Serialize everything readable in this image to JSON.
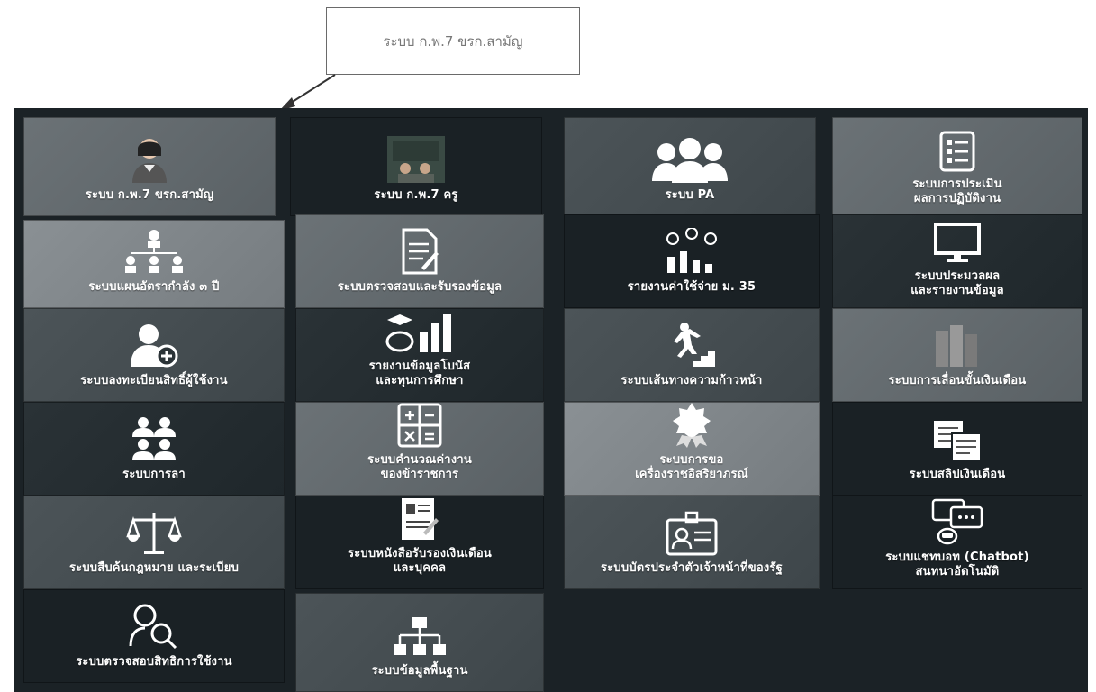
{
  "callout": {
    "text": "ระบบ ก.พ.7 ขรก.สามัญ"
  },
  "tiles": [
    {
      "label1": "ระบบ ก.พ.7 ขรก.สามัญ",
      "label2": "",
      "icon": "person-female-icon"
    },
    {
      "label1": "ระบบ ก.พ.7 ครู",
      "label2": "",
      "icon": "teacher-classroom-icon"
    },
    {
      "label1": "ระบบ PA",
      "label2": "",
      "icon": "people-group-icon"
    },
    {
      "label1": "ระบบการประเมิน",
      "label2": "ผลการปฏิบัติงาน",
      "icon": "checklist-icon"
    },
    {
      "label1": "ระบบแผนอัตรากำลัง ๓ ปี",
      "label2": "",
      "icon": "org-people-icon"
    },
    {
      "label1": "ระบบตรวจสอบและรับรองข้อมูล",
      "label2": "",
      "icon": "document-sign-icon"
    },
    {
      "label1": "รายงานค่าใช้จ่าย ม. 35",
      "label2": "",
      "icon": "money-chart-icon"
    },
    {
      "label1": "ระบบประมวลผล",
      "label2": "และรายงานข้อมูล",
      "icon": "monitor-icon"
    },
    {
      "label1": "ระบบลงทะเบียนสิทธิ์ผู้ใช้งาน",
      "label2": "",
      "icon": "user-add-icon"
    },
    {
      "label1": "รายงานข้อมูลโบนัส",
      "label2": "และทุนการศึกษา",
      "icon": "graduation-chart-icon"
    },
    {
      "label1": "ระบบเส้นทางความก้าวหน้า",
      "label2": "",
      "icon": "stairs-runner-icon"
    },
    {
      "label1": "ระบบการเลื่อนขั้นเงินเดือน",
      "label2": "",
      "icon": "salary-icon"
    },
    {
      "label1": "ระบบการลา",
      "label2": "",
      "icon": "people-icon"
    },
    {
      "label1": "ระบบคำนวณค่างาน",
      "label2": "ของข้าราชการ",
      "icon": "calculator-icon"
    },
    {
      "label1": "ระบบการขอ",
      "label2": "เครื่องราชอิสริยาภรณ์",
      "icon": "medal-icon"
    },
    {
      "label1": "ระบบสลิปเงินเดือน",
      "label2": "",
      "icon": "payslip-icon"
    },
    {
      "label1": "ระบบสืบค้นกฎหมาย และระเบียบ",
      "label2": "",
      "icon": "scales-icon"
    },
    {
      "label1": "ระบบหนังสือรับรองเงินเดือน",
      "label2": "และบุคคล",
      "icon": "certificate-icon"
    },
    {
      "label1": "ระบบบัตรประจำตัวเจ้าหน้าที่ของรัฐ",
      "label2": "",
      "icon": "id-card-icon"
    },
    {
      "label1": "ระบบแชทบอท (Chatbot)",
      "label2": "สนทนาอัตโนมัติ",
      "icon": "chatbot-icon"
    },
    {
      "label1": "ระบบตรวจสอบสิทธิการใช้งาน",
      "label2": "",
      "icon": "user-search-icon"
    },
    {
      "label1": "ระบบข้อมูลพื้นฐาน",
      "label2": "",
      "icon": "hierarchy-icon"
    }
  ]
}
